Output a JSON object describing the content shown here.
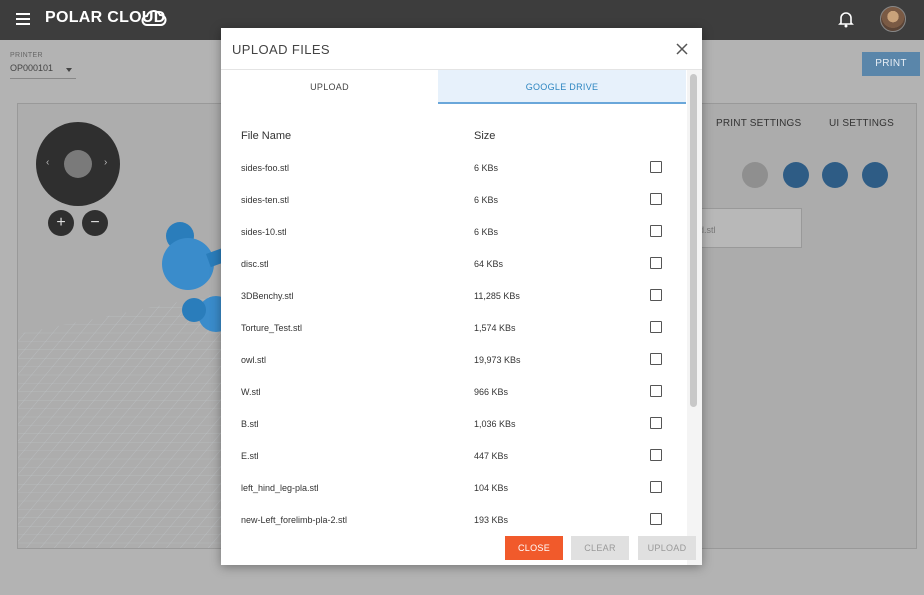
{
  "app": {
    "logo_text": "POLAR CLOUD"
  },
  "background": {
    "printer_label": "PRINTER",
    "printer_value": "OP000101",
    "print_button": "PRINT",
    "panel_tabs": [
      "PRINT SETTINGS",
      "UI SETTINGS"
    ],
    "file_card_text": "d.stl"
  },
  "modal": {
    "title": "UPLOAD FILES",
    "tabs": {
      "upload": "UPLOAD",
      "google_drive": "GOOGLE DRIVE"
    },
    "active_tab": "google_drive",
    "columns": {
      "name": "File Name",
      "size": "Size"
    },
    "files": [
      {
        "name": "sides-foo.stl",
        "size": "6 KBs"
      },
      {
        "name": "sides-ten.stl",
        "size": "6 KBs"
      },
      {
        "name": "sides-10.stl",
        "size": "6 KBs"
      },
      {
        "name": "disc.stl",
        "size": "64 KBs"
      },
      {
        "name": "3DBenchy.stl",
        "size": "11,285 KBs"
      },
      {
        "name": "Torture_Test.stl",
        "size": "1,574 KBs"
      },
      {
        "name": "owl.stl",
        "size": "19,973 KBs"
      },
      {
        "name": "W.stl",
        "size": "966 KBs"
      },
      {
        "name": "B.stl",
        "size": "1,036 KBs"
      },
      {
        "name": "E.stl",
        "size": "447 KBs"
      },
      {
        "name": "left_hind_leg-pla.stl",
        "size": "104 KBs"
      },
      {
        "name": "new-Left_forelimb-pla-2.stl",
        "size": "193 KBs"
      }
    ],
    "buttons": {
      "close": "CLOSE",
      "clear": "CLEAR",
      "upload": "UPLOAD"
    }
  },
  "colors": {
    "accent_blue": "#2e86c1",
    "close_orange": "#f15a2b",
    "topbar": "#3d3d3d"
  }
}
